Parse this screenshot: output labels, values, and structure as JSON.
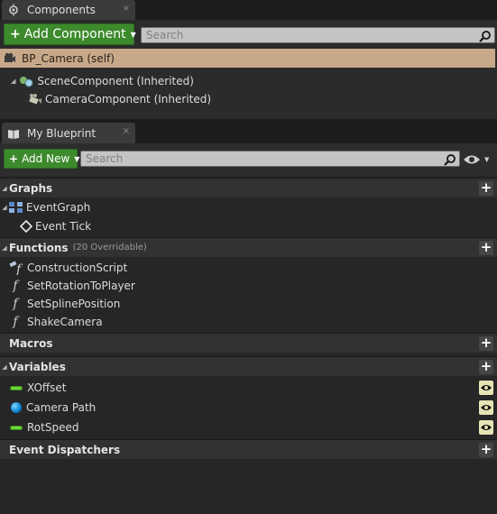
{
  "components_panel": {
    "tab_label": "Components",
    "tab_close": "×",
    "add_component_label": "Add Component",
    "search_placeholder": "Search",
    "self_item": "BP_Camera (self)",
    "tree": [
      {
        "label": "SceneComponent (Inherited)",
        "icon": "scene-component-icon"
      },
      {
        "label": "CameraComponent (Inherited)",
        "icon": "camera-icon"
      }
    ]
  },
  "blueprint_panel": {
    "tab_label": "My Blueprint",
    "tab_close": "×",
    "add_new_label": "Add New",
    "search_placeholder": "Search",
    "categories": {
      "graphs": {
        "label": "Graphs",
        "items": [
          "EventGraph",
          "Event Tick"
        ]
      },
      "functions": {
        "label": "Functions",
        "sub": "(20 Overridable)",
        "items": [
          "ConstructionScript",
          "SetRotationToPlayer",
          "SetSplinePosition",
          "ShakeCamera"
        ]
      },
      "macros": {
        "label": "Macros"
      },
      "variables": {
        "label": "Variables",
        "items": [
          {
            "label": "XOffset",
            "type_icon": "float-pill-icon",
            "color": "#6bd63a"
          },
          {
            "label": "Camera Path",
            "type_icon": "object-sphere-icon",
            "color": "#0a7fcf"
          },
          {
            "label": "RotSpeed",
            "type_icon": "float-pill-icon",
            "color": "#6bd63a"
          }
        ]
      },
      "event_dispatchers": {
        "label": "Event Dispatchers"
      }
    }
  },
  "colors": {
    "accent_green": "#3d8a2d",
    "selection_tan": "#c7a98a",
    "panel_bg": "#2b2b2b"
  }
}
